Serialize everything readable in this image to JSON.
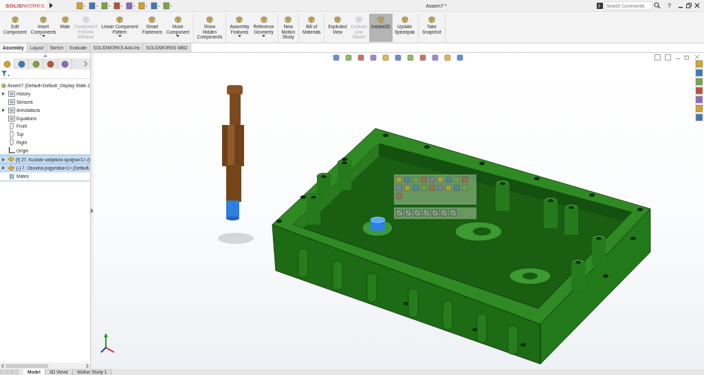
{
  "app": {
    "logo": "**SOLID**WORKS",
    "document_title": "Assem7 *",
    "search": {
      "placeholder": "Search Commands"
    },
    "help": "?"
  },
  "ribbon": {
    "groups": [
      [
        {
          "label": "Edit\nComponent",
          "disabled": false,
          "selected": false,
          "has_menu": false
        },
        {
          "label": "Insert\nComponents",
          "disabled": false,
          "selected": false,
          "has_menu": true
        },
        {
          "label": "Mate",
          "disabled": false,
          "selected": false,
          "has_menu": false
        },
        {
          "label": "Component\nPreview\nWindow",
          "disabled": true,
          "selected": false,
          "has_menu": false
        },
        {
          "label": "Linear Component\nPattern",
          "disabled": false,
          "selected": false,
          "has_menu": true
        },
        {
          "label": "Smart\nFasteners",
          "disabled": false,
          "selected": false,
          "has_menu": false
        },
        {
          "label": "Move\nComponent",
          "disabled": false,
          "selected": false,
          "has_menu": true
        }
      ],
      [
        {
          "label": "Show\nHidden\nComponents",
          "disabled": false,
          "selected": false,
          "has_menu": false
        }
      ],
      [
        {
          "label": "Assembly\nFeatures",
          "disabled": false,
          "selected": false,
          "has_menu": true
        },
        {
          "label": "Reference\nGeometry",
          "disabled": false,
          "selected": false,
          "has_menu": true
        }
      ],
      [
        {
          "label": "New\nMotion\nStudy",
          "disabled": false,
          "selected": false,
          "has_menu": false
        }
      ],
      [
        {
          "label": "Bill of\nMaterials",
          "disabled": false,
          "selected": false,
          "has_menu": false
        }
      ],
      [
        {
          "label": "Exploded\nView",
          "disabled": false,
          "selected": false,
          "has_menu": false
        },
        {
          "label": "Explode\nLine\nSketch",
          "disabled": true,
          "selected": false,
          "has_menu": false
        },
        {
          "label": "Instant3D",
          "disabled": false,
          "selected": true,
          "has_menu": false
        },
        {
          "label": "Update\nSpeedpak",
          "disabled": false,
          "selected": false,
          "has_menu": false
        }
      ],
      [
        {
          "label": "Take\nSnapshot",
          "disabled": false,
          "selected": false,
          "has_menu": false
        }
      ]
    ]
  },
  "tabs": [
    {
      "label": "Assembly",
      "selected": true
    },
    {
      "label": "Layout",
      "selected": false
    },
    {
      "label": "Sketch",
      "selected": false
    },
    {
      "label": "Evaluate",
      "selected": false
    },
    {
      "label": "SOLIDWORKS Add-Ins",
      "selected": false
    },
    {
      "label": "SOLIDWORKS MBD",
      "selected": false
    }
  ],
  "feature_tree": {
    "root": "Assem7  (Default<Default_Display State-1",
    "items": [
      {
        "label": "History",
        "kind": "folder",
        "expandable": true,
        "selected": false
      },
      {
        "label": "Sensors",
        "kind": "folder",
        "expandable": false,
        "selected": false
      },
      {
        "label": "Annotations",
        "kind": "folder",
        "expandable": true,
        "selected": false
      },
      {
        "label": "Equations",
        "kind": "folder",
        "expandable": false,
        "selected": false
      },
      {
        "label": "Front",
        "kind": "plane",
        "expandable": false,
        "selected": false
      },
      {
        "label": "Top",
        "kind": "plane",
        "expandable": false,
        "selected": false
      },
      {
        "label": "Right",
        "kind": "plane",
        "expandable": false,
        "selected": false
      },
      {
        "label": "Origin",
        "kind": "origin",
        "expandable": false,
        "selected": false
      },
      {
        "label": "(f) 27. Kuciste varijatora spoljna<1> (I",
        "kind": "part",
        "expandable": true,
        "selected": true
      },
      {
        "label": "(-) 7. Osovina pogonska<1> (Default-",
        "kind": "part",
        "expandable": true,
        "selected": true
      },
      {
        "label": "Mates",
        "kind": "mates",
        "expandable": false,
        "selected": false
      }
    ]
  },
  "panel_tabs": [
    {
      "selected": true
    },
    {
      "selected": false
    },
    {
      "selected": false
    },
    {
      "selected": false
    },
    {
      "selected": false
    }
  ],
  "bottom_tabs": [
    {
      "label": "Model",
      "selected": true
    },
    {
      "label": "3D Views",
      "selected": false
    },
    {
      "label": "Motion Study 1",
      "selected": false
    }
  ]
}
